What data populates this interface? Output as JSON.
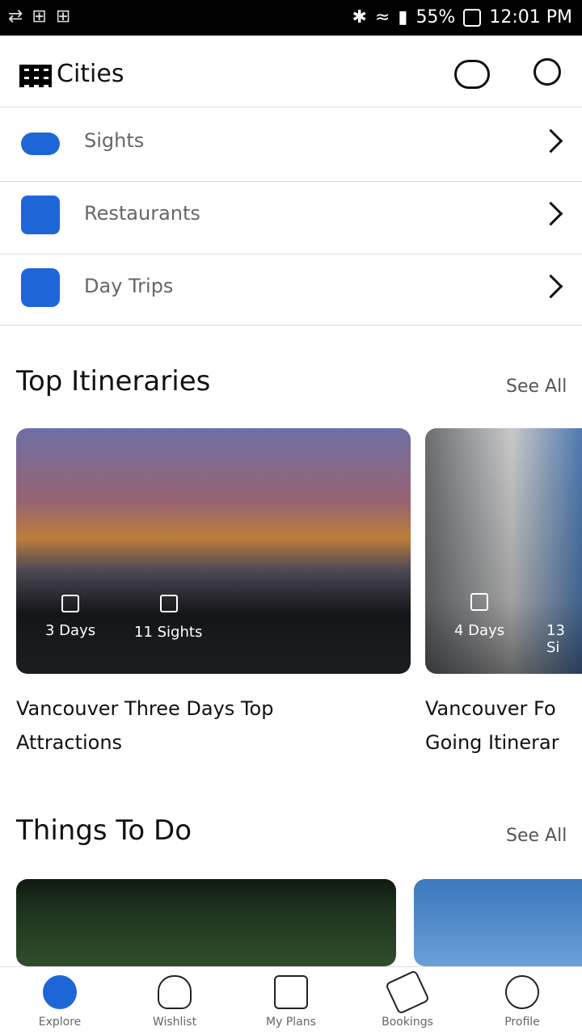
{
  "status_bar": {
    "left_glyphs": "⇄ ⊞ ⊞",
    "battery": "55%",
    "time": "12:01 PM"
  },
  "header": {
    "title": "Cities",
    "icons": [
      "grid-icon",
      "cloud-download-icon",
      "search-icon"
    ]
  },
  "menu": [
    {
      "label": "Sights",
      "icon": "eye-icon"
    },
    {
      "label": "Restaurants",
      "icon": "fork-knife-icon"
    },
    {
      "label": "Day Trips",
      "icon": "binoculars-icon"
    }
  ],
  "top_itineraries": {
    "title": "Top Itineraries",
    "see_all": "See All",
    "cards": [
      {
        "days": "3 Days",
        "sights": "11 Sights",
        "caption": "Vancouver Three Days Top Attractions"
      },
      {
        "days": "4 Days",
        "sights": "13 Si",
        "caption": "Vancouver Fo Going Itinerar"
      }
    ]
  },
  "things_to_do": {
    "title": "Things To Do",
    "see_all": "See All"
  },
  "bottom_nav": [
    {
      "label": "Explore",
      "icon": "compass-icon"
    },
    {
      "label": "Wishlist",
      "icon": "heart-icon"
    },
    {
      "label": "My Plans",
      "icon": "map-icon"
    },
    {
      "label": "Bookings",
      "icon": "ticket-icon"
    },
    {
      "label": "Profile",
      "icon": "user-icon"
    }
  ],
  "colors": {
    "accent_blue": "#1e66d8",
    "divider": "#d9d9d9"
  }
}
